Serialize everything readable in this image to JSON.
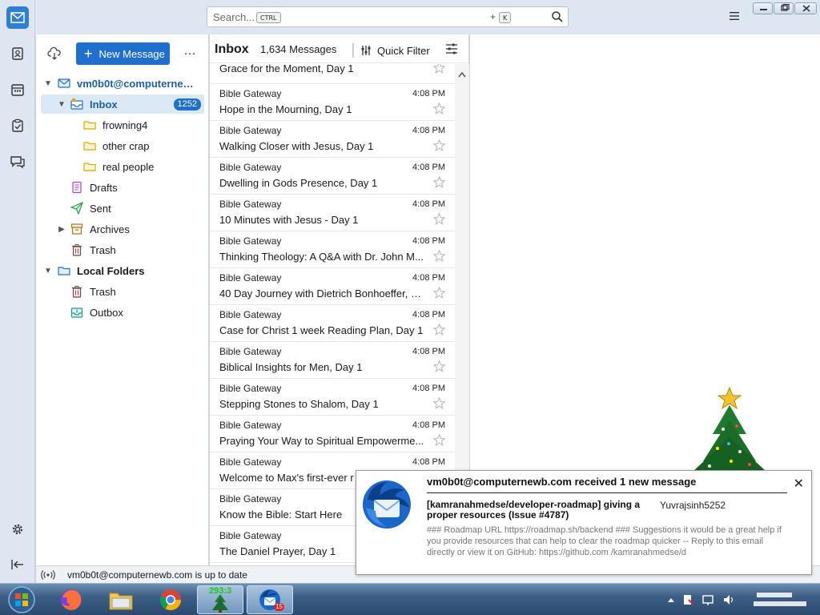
{
  "search": {
    "placeholder": "Search...",
    "key1": "CTRL",
    "plus": "+",
    "key2": "K"
  },
  "toolbar": {
    "new_message_label": "New Message",
    "more_label": "…"
  },
  "folders": {
    "account": "vm0b0t@computernewb.com",
    "inbox": {
      "label": "Inbox",
      "count": "1252"
    },
    "sub": [
      "frowning4",
      "other crap",
      "real people"
    ],
    "drafts": "Drafts",
    "sent": "Sent",
    "archives": "Archives",
    "trash": "Trash",
    "local_folders": "Local Folders",
    "local_trash": "Trash",
    "outbox": "Outbox"
  },
  "thread": {
    "folder_name": "Inbox",
    "message_count": "1,634 Messages",
    "quick_filter": "Quick Filter",
    "messages": [
      {
        "sender": "",
        "time": "",
        "subject": "Grace for the Moment, Day 1"
      },
      {
        "sender": "Bible Gateway",
        "time": "4:08 PM",
        "subject": "Hope in the Mourning, Day 1"
      },
      {
        "sender": "Bible Gateway",
        "time": "4:08 PM",
        "subject": "Walking Closer with Jesus, Day 1"
      },
      {
        "sender": "Bible Gateway",
        "time": "4:08 PM",
        "subject": "Dwelling in Gods Presence, Day 1"
      },
      {
        "sender": "Bible Gateway",
        "time": "4:08 PM",
        "subject": "10 Minutes with Jesus - Day 1"
      },
      {
        "sender": "Bible Gateway",
        "time": "4:08 PM",
        "subject": "Thinking Theology: A Q&A with Dr. John M..."
      },
      {
        "sender": "Bible Gateway",
        "time": "4:08 PM",
        "subject": "40 Day Journey with Dietrich Bonhoeffer, D..."
      },
      {
        "sender": "Bible Gateway",
        "time": "4:08 PM",
        "subject": "Case for Christ 1 week Reading Plan, Day 1"
      },
      {
        "sender": "Bible Gateway",
        "time": "4:08 PM",
        "subject": "Biblical Insights for Men, Day 1"
      },
      {
        "sender": "Bible Gateway",
        "time": "4:08 PM",
        "subject": "Stepping Stones to Shalom, Day 1"
      },
      {
        "sender": "Bible Gateway",
        "time": "4:08 PM",
        "subject": "Praying Your Way to Spiritual Empowerme..."
      },
      {
        "sender": "Bible Gateway",
        "time": "4:08 PM",
        "subject": "Welcome to Max's first-ever r"
      },
      {
        "sender": "Bible Gateway",
        "time": "",
        "subject": "Know the Bible: Start Here"
      },
      {
        "sender": "Bible Gateway",
        "time": "",
        "subject": "The Daniel Prayer, Day 1"
      }
    ]
  },
  "status": {
    "text": "vm0b0t@computernewb.com is up to date"
  },
  "notification": {
    "title": "vm0b0t@computernewb.com received 1 new message",
    "close": "✕",
    "subject": "[kamranahmedse/developer-roadmap] giving a proper resources (Issue #4787)",
    "from": "Yuvrajsinh5252",
    "body": "### Roadmap URL https://roadmap.sh/backend ### Suggestions it would be a great help if you provide resources that can help to clear the roadmap quicker -- Reply to this email directly or view it on GitHub: https://github.com /kamranahmedse/d"
  },
  "taskbar": {
    "gadget_label": "293:3",
    "mail_badge": "15"
  },
  "colors": {
    "accent": "#1f6fcf",
    "selected_row": "#dbe8f6",
    "taskbar": "#3e5f85"
  },
  "icons": [
    "mail-icon",
    "address-book-icon",
    "calendar-icon",
    "tasks-icon",
    "chat-icon",
    "settings-icon",
    "collapse-icon",
    "search-icon",
    "hamburger-menu-icon",
    "get-mail-icon",
    "folder-icon",
    "drafts-icon",
    "sent-icon",
    "archive-icon",
    "trash-icon",
    "outbox-icon",
    "star-icon",
    "quick-filter-icon",
    "display-options-icon",
    "online-status-icon",
    "thunderbird-logo-icon"
  ]
}
